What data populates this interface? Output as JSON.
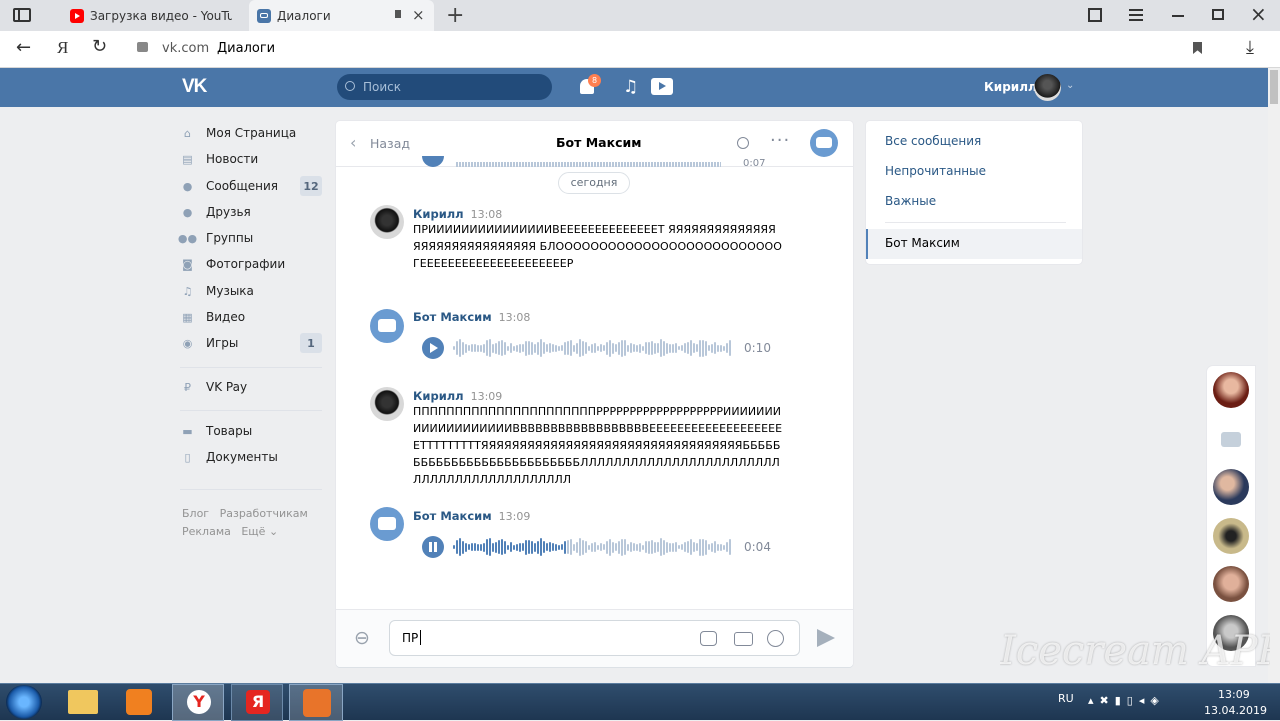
{
  "browser": {
    "tabs": [
      {
        "label": "Загрузка видео - YouTube",
        "favicon_color": "#ff0000"
      },
      {
        "label": "Диалоги",
        "favicon_color": "#4a76a8"
      }
    ],
    "url_domain": "vk.com",
    "url_title": "Диалоги"
  },
  "vk": {
    "search_placeholder": "Поиск",
    "notif_count": "8",
    "user_name": "Кирилл",
    "menu": [
      {
        "label": "Моя Страница",
        "icon": "home-icon"
      },
      {
        "label": "Новости",
        "icon": "news-icon"
      },
      {
        "label": "Сообщения",
        "icon": "messages-icon",
        "badge": "12"
      },
      {
        "label": "Друзья",
        "icon": "friends-icon"
      },
      {
        "label": "Группы",
        "icon": "groups-icon"
      },
      {
        "label": "Фотографии",
        "icon": "camera-icon"
      },
      {
        "label": "Музыка",
        "icon": "music-icon"
      },
      {
        "label": "Видео",
        "icon": "video-icon"
      },
      {
        "label": "Игры",
        "icon": "games-icon",
        "badge": "1"
      },
      {
        "label": "VK Pay",
        "icon": "vkpay-icon"
      },
      {
        "label": "Товары",
        "icon": "market-icon"
      },
      {
        "label": "Документы",
        "icon": "docs-icon"
      }
    ],
    "footer_links": [
      "Блог",
      "Разработчикам",
      "Реклама",
      "Ещё"
    ]
  },
  "chat": {
    "back_label": "Назад",
    "title": "Бот Максим",
    "date_chip": "сегодня",
    "top_partial_duration": "0:07",
    "messages": [
      {
        "name": "Кирилл",
        "time": "13:08",
        "text": "ПРИИИИИИИИИИИИИИИВЕЕЕЕЕЕЕЕЕЕЕЕЕЕТ ЯЯЯЯЯЯЯЯЯЯЯЯЯЯЯЯЯЯЯЯЯЯЯЯЯЯЯЯЯЯ БЛООООООООООООООООООООООООООГЕЕЕЕЕЕЕЕЕЕЕЕЕЕЕЕЕЕЕЕЕР"
      },
      {
        "name": "Бот Максим",
        "time": "13:08",
        "duration": "0:10"
      },
      {
        "name": "Кирилл",
        "time": "13:09",
        "text": "ППППППППППППППППППППППРРРРРРРРРРРРРРРРРРРИИИИИИИИИИИИИИИИИИИВВВВВВВВВВВВВВВВВВЕЕЕЕЕЕЕЕЕЕЕЕЕЕЕЕЕЕЕЕТТТТТТТТТЯЯЯЯЯЯЯЯЯЯЯЯЯЯЯЯЯЯЯЯЯЯЯЯЯЯЯЯЯЯЯЯЯЯБББББББББББББББББББББББББББЛЛЛЛЛЛЛЛЛЛЛЛЛЛЛЛЛЛЛЛЛЛЛЛЛЛЛЛЛЛЛЛЛЛЛЛЛЛЛЛЛЛЛ"
      },
      {
        "name": "Бот Максим",
        "time": "13:09",
        "duration": "0:04"
      }
    ],
    "input_value": "ПР"
  },
  "right_nav": {
    "items": [
      "Все сообщения",
      "Непрочитанные",
      "Важные"
    ],
    "active": "Бот Максим"
  },
  "taskbar": {
    "lang": "RU",
    "time": "13:09",
    "date": "13.04.2019"
  },
  "watermark": "Icecream APPS",
  "colors": {
    "vk_blue": "#4a76a8",
    "link": "#2a5885",
    "play": "#5181b8"
  }
}
